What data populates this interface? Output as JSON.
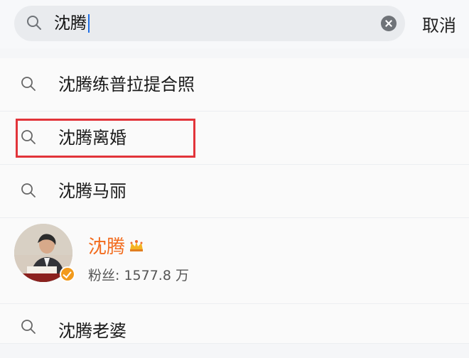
{
  "search": {
    "value": "沈腾",
    "cancel_label": "取消"
  },
  "suggestions": [
    {
      "label": "沈腾练普拉提合照"
    },
    {
      "label": "沈腾离婚",
      "highlighted": true
    },
    {
      "label": "沈腾马丽"
    }
  ],
  "user_result": {
    "name": "沈腾",
    "fans_label": "粉丝: 1577.8 万",
    "name_color": "#f26b1d",
    "badge_color": "#f29a1b"
  },
  "more_suggestions": [
    {
      "label": "沈腾老婆"
    }
  ],
  "colors": {
    "highlight_box": "#e2343a",
    "caret": "#1f6fe5"
  },
  "icons": {
    "search": "magnifier-icon",
    "clear": "clear-circle-icon",
    "crown": "crown-icon",
    "verified": "verified-check-icon"
  }
}
